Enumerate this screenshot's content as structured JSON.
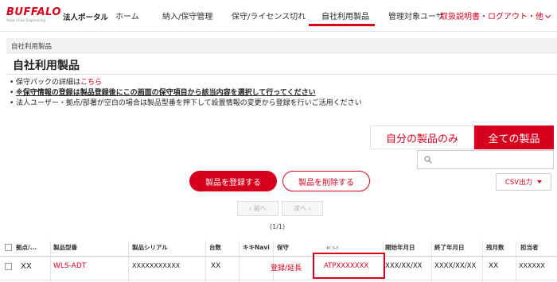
{
  "brand": {
    "logo_text": "BUFFALO",
    "logo_tagline": "Value Chain Engineering"
  },
  "header": {
    "portal_title": "法人ポータル",
    "nav": [
      "ホーム",
      "納入/保守管理",
      "保守/ライセンス切れ",
      "自社利用製品",
      "管理対象ユーザ"
    ],
    "active_nav": "自社利用製品",
    "manual_label": "取扱説明書・ログアウト・他"
  },
  "breadcrumb": "自社利用製品",
  "page_title": "自社利用製品",
  "notes": {
    "line1_prefix": "保守パックの詳細は",
    "line1_link": "こちら",
    "line2": "※保守情報の登録は製品登録後にこの画面の保守項目から該当内容を選択して行ってください",
    "line3": "法人ユーザー・拠点/部署が空白の場合は製品型番を押下して設置情報の変更から登録を行いご活用ください"
  },
  "toggle": {
    "mine": "自分の製品のみ",
    "all": "全ての製品",
    "selected": "all"
  },
  "search": {
    "value": "",
    "placeholder": ""
  },
  "csv": {
    "label": "CSV出力"
  },
  "actions": {
    "register": "製品を登録する",
    "delete": "製品を削除する"
  },
  "pager": {
    "prev": "前へ",
    "next": "次へ",
    "count": "(1/1)"
  },
  "table": {
    "headers": [
      "拠点/...",
      "製品型番",
      "製品シリアル",
      "台数",
      "キキNavi",
      "保守",
      "ｷｷﾞﾜｰｸ",
      "開始年月日",
      "終了年月日",
      "残月数",
      "担当者"
    ],
    "rows": [
      [
        "XX",
        "WLS-ADT",
        "XXXXXXXXXXX",
        "XX",
        "",
        "登録/延長",
        "ATPXXXXXXX",
        "XXX/XX/XX",
        "XXXX/XX/XX",
        "XX",
        "XXXXXX"
      ]
    ]
  },
  "colors": {
    "accent": "#d6001c"
  }
}
